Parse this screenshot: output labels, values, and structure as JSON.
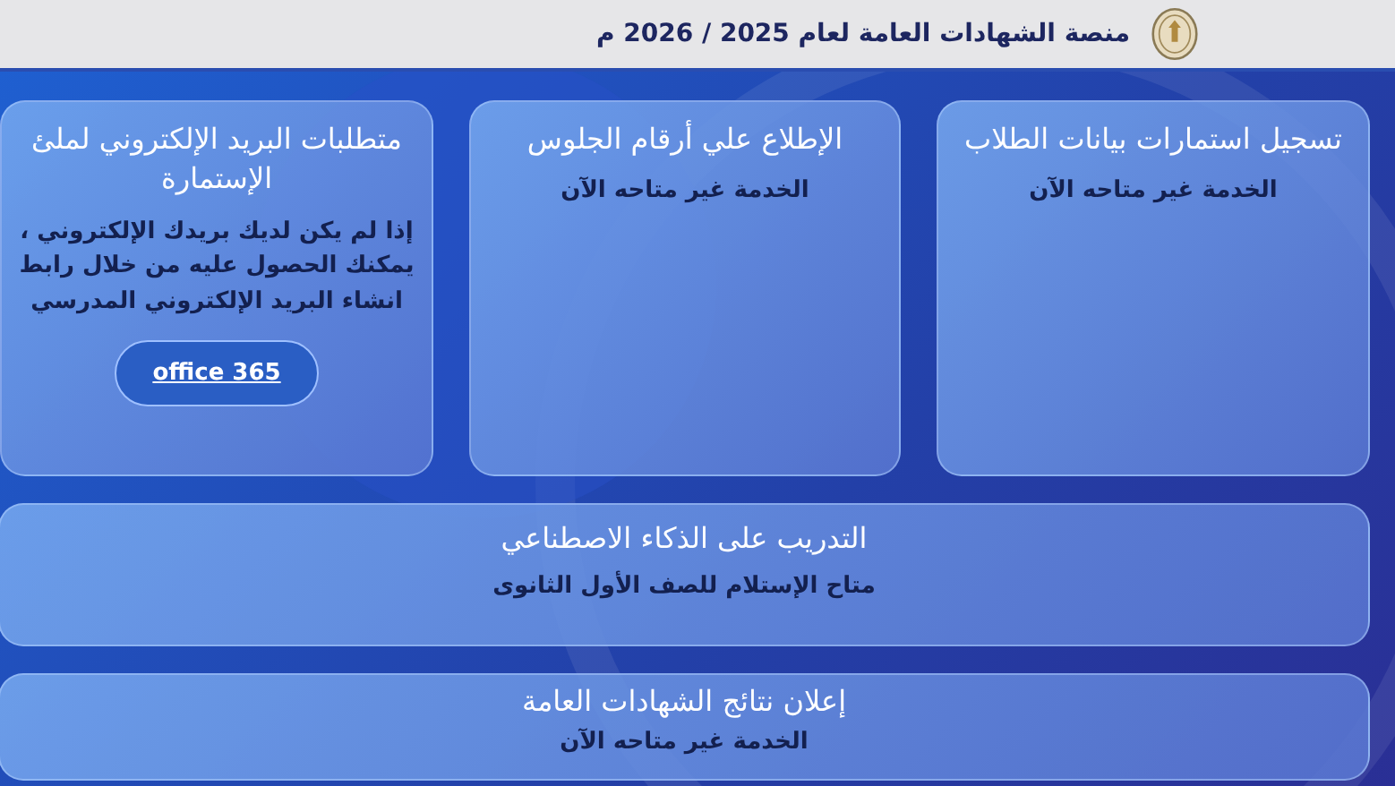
{
  "header": {
    "title": "منصة الشهادات العامة لعام 2025 / 2026 م"
  },
  "cards": [
    {
      "kind": "tile",
      "title": "تسجيل استمارات بيانات الطلاب",
      "text": "الخدمة غير متاحه الآن"
    },
    {
      "kind": "tile",
      "title": "الإطلاع علي أرقام الجلوس",
      "text": "الخدمة غير متاحه الآن"
    },
    {
      "kind": "tile",
      "title": "متطلبات البريد الإلكتروني لملئ الإستمارة",
      "text": "إذا لم يكن لديك بريدك الإلكتروني ، يمكنك الحصول عليه من خلال رابط انشاء البريد الإلكتروني المدرسي",
      "button": "office 365"
    },
    {
      "kind": "wide",
      "title": "التدريب على الذكاء الاصطناعي",
      "text": "متاح الإستلام للصف الأول الثانوى"
    },
    {
      "kind": "wide",
      "title": "إعلان نتائج الشهادات العامة",
      "text": "الخدمة غير متاحه الآن"
    }
  ]
}
